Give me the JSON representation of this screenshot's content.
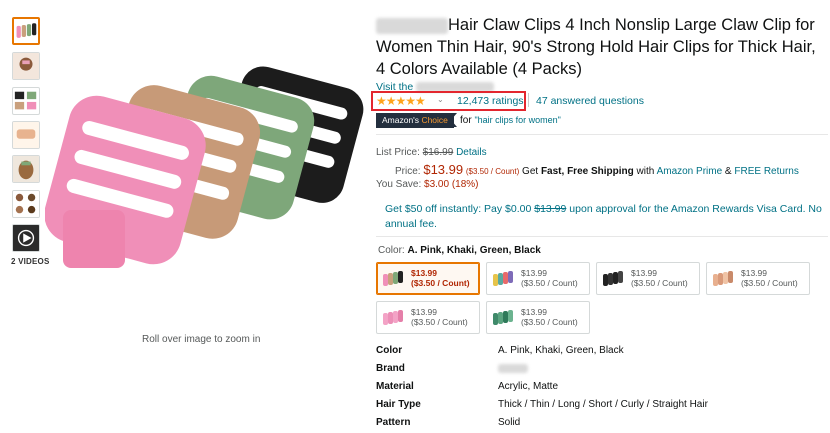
{
  "colors": {
    "link": "#007185",
    "price_red": "#b12704",
    "star": "#ffa41c",
    "selected_border": "#e77600",
    "highlight_box": "#e3262e",
    "badge_bg": "#232f3e"
  },
  "gallery": {
    "video_label": "2 VIDEOS",
    "zoom_hint": "Roll over image to zoom in"
  },
  "product": {
    "title": "Hair Claw Clips 4 Inch Nonslip Large Claw Clip for Women Thin Hair, 90's Strong Hold Hair Clips for Thick Hair, 4 Colors Available (4 Packs)",
    "visit_text": "Visit the",
    "stars_glyph": "★★★★★",
    "ratings": "12,473 ratings",
    "answered": "47 answered questions",
    "badge_prefix": "Amazon's",
    "badge_suffix": "Choice",
    "badge_for": "for",
    "badge_query": "\"hair clips for women\""
  },
  "pricing": {
    "list_label": "List Price:",
    "list_price": "$16.99",
    "details": "Details",
    "price_label": "Price:",
    "price": "$13.99",
    "unit": "($3.50 / Count)",
    "shipping_prefix": "Get",
    "shipping_bold": "Fast, Free Shipping",
    "shipping_with": "with",
    "prime": "Amazon Prime",
    "amp": "&",
    "returns": "FREE Returns",
    "save_label": "You Save:",
    "save_value": "$3.00 (18%)"
  },
  "offer": {
    "text_a": "Get $50 off instantly: Pay $0.00",
    "struck": "$13.99",
    "text_b": "upon approval for the Amazon Rewards Visa Card. No annual fee."
  },
  "color_selector": {
    "label": "Color:",
    "selected": "A. Pink, Khaki, Green, Black",
    "options": [
      {
        "price": "$13.99",
        "unit": "($3.50 / Count)"
      },
      {
        "price": "$13.99",
        "unit": "($3.50 / Count)"
      },
      {
        "price": "$13.99",
        "unit": "($3.50 / Count)"
      },
      {
        "price": "$13.99",
        "unit": "($3.50 / Count)"
      },
      {
        "price": "$13.99",
        "unit": "($3.50 / Count)"
      },
      {
        "price": "$13.99",
        "unit": "($3.50 / Count)"
      }
    ]
  },
  "specs": [
    {
      "label": "Color",
      "value": "A. Pink, Khaki, Green, Black"
    },
    {
      "label": "Brand",
      "value": ""
    },
    {
      "label": "Material",
      "value": "Acrylic, Matte"
    },
    {
      "label": "Hair Type",
      "value": "Thick / Thin / Long / Short / Curly / Straight Hair"
    },
    {
      "label": "Pattern",
      "value": "Solid"
    }
  ]
}
